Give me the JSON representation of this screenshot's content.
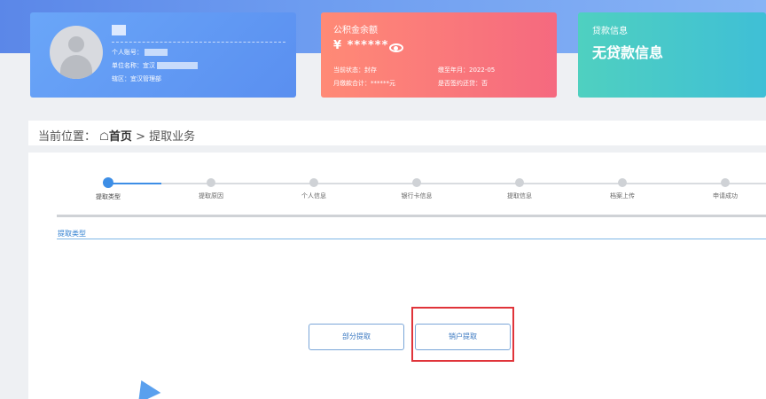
{
  "user_card": {
    "account_label": "个人账号：",
    "employer_label": "单位名称：宜汉",
    "district_label": "辖区：宜汉管理部"
  },
  "fund_card": {
    "title": "公积金余额",
    "amount": "¥ ******",
    "status": "当前状态：封存",
    "paid_until": "缴至年月：2022-05",
    "monthly_total": "月缴款合计：******元",
    "contract_signed": "是否签约还贷：否"
  },
  "loan_card": {
    "title": "贷款信息",
    "value": "无贷款信息"
  },
  "breadcrumb": {
    "prefix": "当前位置：",
    "home_icon": "home-icon",
    "home": "首页",
    "separator": ">",
    "current": "提取业务"
  },
  "steps": [
    {
      "label": "提取类型",
      "active": true
    },
    {
      "label": "提取原因",
      "active": false
    },
    {
      "label": "个人信息",
      "active": false
    },
    {
      "label": "银行卡信息",
      "active": false
    },
    {
      "label": "提取信息",
      "active": false
    },
    {
      "label": "档案上传",
      "active": false
    },
    {
      "label": "申请成功",
      "active": false
    }
  ],
  "section": {
    "title": "提取类型"
  },
  "buttons": {
    "partial": "部分提取",
    "close_account": "销户提取"
  },
  "colors": {
    "accent": "#3d8ee6",
    "fund_card": "#f5697f",
    "loan_card": "#3fbfd6",
    "highlight": "#e0343a"
  }
}
